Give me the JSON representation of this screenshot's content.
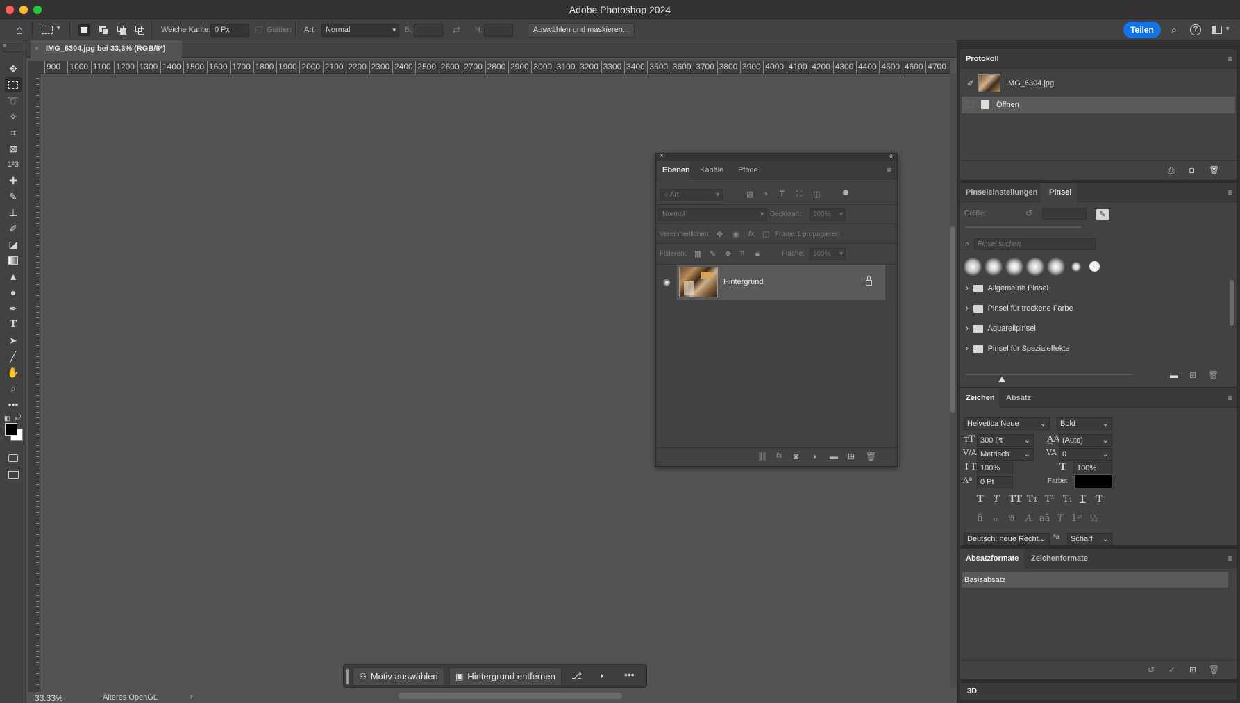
{
  "window": {
    "title": "Adobe Photoshop 2024"
  },
  "options_bar": {
    "feather_label": "Weiche Kante:",
    "feather_value": "0 Px",
    "antialias_label": "Glätten",
    "style_label": "Art:",
    "style_value": "Normal",
    "width_label": "B:",
    "height_label": "H:",
    "select_mask_label": "Auswählen und maskieren...",
    "share_label": "Teilen"
  },
  "document": {
    "tab_title": "IMG_6304.jpg bei 33,3% (RGB/8*)",
    "ruler_ticks": [
      "900",
      "1000",
      "1100",
      "1200",
      "1300",
      "1400",
      "1500",
      "1600",
      "1700",
      "1800",
      "1900",
      "2000",
      "2100",
      "2200",
      "2300",
      "2400",
      "2500",
      "2600",
      "2700",
      "2800",
      "2900",
      "3000",
      "3100",
      "3200",
      "3300",
      "3400",
      "3500",
      "3600",
      "3700",
      "3800",
      "3900",
      "4000",
      "4100",
      "4200",
      "4300",
      "4400",
      "4500",
      "4600",
      "4700"
    ]
  },
  "status": {
    "zoom": "33.33%",
    "info": "Älteres OpenGL"
  },
  "context_bar": {
    "select_subject": "Motiv auswählen",
    "remove_bg": "Hintergrund entfernen"
  },
  "layers_panel": {
    "tabs": [
      "Ebenen",
      "Kanäle",
      "Pfade"
    ],
    "filter_placeholder": "Art",
    "blend_mode": "Normal",
    "opacity_label": "Deckkraft:",
    "opacity_value": "100%",
    "unify_label": "Vereinheitlichen:",
    "propagate_label": "Frame 1 propagieren",
    "lock_label": "Fixieren:",
    "fill_label": "Fläche:",
    "fill_value": "100%",
    "layers": [
      {
        "name": "Hintergrund",
        "visible": true,
        "locked": true
      }
    ]
  },
  "history_panel": {
    "title": "Protokoll",
    "snapshot": "IMG_6304.jpg",
    "items": [
      "Öffnen"
    ]
  },
  "brush_panel": {
    "tabs": [
      "Pinseleinstellungen",
      "Pinsel"
    ],
    "size_label": "Größe:",
    "search_placeholder": "Pinsel suchen",
    "folders": [
      "Allgemeine Pinsel",
      "Pinsel für trockene Farbe",
      "Aquarellpinsel",
      "Pinsel für Spezialeffekte"
    ]
  },
  "character_panel": {
    "tabs": [
      "Zeichen",
      "Absatz"
    ],
    "font_family": "Helvetica Neue",
    "font_style": "Bold",
    "font_size": "300 Pt",
    "leading": "(Auto)",
    "kerning": "Metrisch",
    "tracking": "0",
    "vertical_scale": "100%",
    "horizontal_scale": "100%",
    "baseline_shift": "0 Pt",
    "color_label": "Farbe:",
    "color": "#000000",
    "language": "Deutsch: neue Recht...",
    "antialias": "Scharf"
  },
  "paragraph_styles_panel": {
    "tabs": [
      "Absatzformate",
      "Zeichenformate"
    ],
    "items": [
      "Basisabsatz"
    ]
  },
  "three_d_panel": {
    "label": "3D"
  },
  "colors": {
    "accent": "#1473e6",
    "bg": "#535353",
    "panel": "#424242"
  }
}
